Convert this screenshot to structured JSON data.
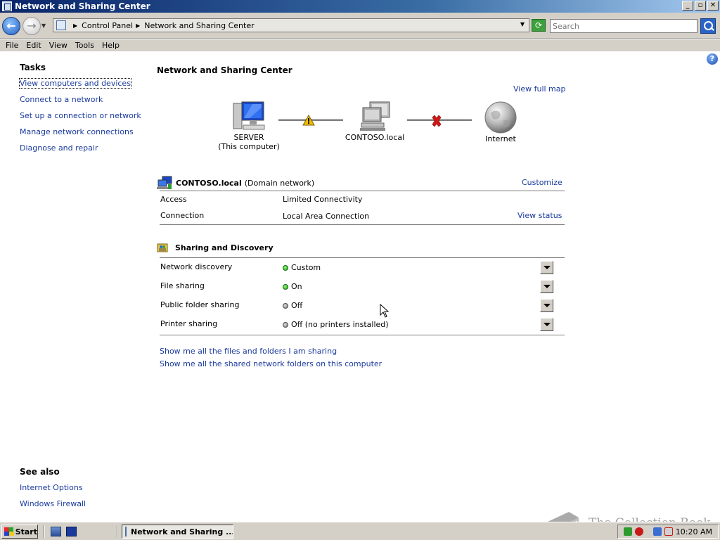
{
  "window": {
    "title": "Network and Sharing Center",
    "buttons": {
      "minimize": "_",
      "maximize": "▫",
      "close": "✕"
    }
  },
  "address": {
    "crumbs": [
      "Control Panel",
      "Network and Sharing Center"
    ],
    "search_placeholder": "Search"
  },
  "menu": [
    "File",
    "Edit",
    "View",
    "Tools",
    "Help"
  ],
  "tasks": {
    "title": "Tasks",
    "items": [
      "View computers and devices",
      "Connect to a network",
      "Set up a connection or network",
      "Manage network connections",
      "Diagnose and repair"
    ]
  },
  "see_also": {
    "title": "See also",
    "items": [
      "Internet Options",
      "Windows Firewall"
    ]
  },
  "main": {
    "title": "Network and Sharing Center",
    "view_full_map": "View full map",
    "map": {
      "computer_name": "SERVER",
      "computer_sub": "(This computer)",
      "network_name": "CONTOSO.local",
      "internet_name": "Internet"
    },
    "network": {
      "name": "CONTOSO.local",
      "type": "(Domain network)",
      "customize": "Customize",
      "rows": [
        {
          "label": "Access",
          "value": "Limited Connectivity",
          "action": ""
        },
        {
          "label": "Connection",
          "value": "Local Area Connection",
          "action": "View status"
        }
      ]
    },
    "sharing": {
      "title": "Sharing and Discovery",
      "rows": [
        {
          "label": "Network discovery",
          "value": "Custom",
          "status": "on"
        },
        {
          "label": "File sharing",
          "value": "On",
          "status": "on"
        },
        {
          "label": "Public folder sharing",
          "value": "Off",
          "status": "off"
        },
        {
          "label": "Printer sharing",
          "value": "Off (no printers installed)",
          "status": "off"
        }
      ]
    },
    "links": [
      "Show me all the files and folders I am sharing",
      "Show me all the shared network folders on this computer"
    ]
  },
  "watermark": "The Collection Book",
  "taskbar": {
    "start": "Start",
    "task": "Network and Sharing ...",
    "clock": "10:20 AM"
  },
  "colors": {
    "link": "#1a3a9c",
    "status_on": "#1f9a1f",
    "status_off": "#707070",
    "warning": "#f0c000",
    "error": "#d01818"
  }
}
